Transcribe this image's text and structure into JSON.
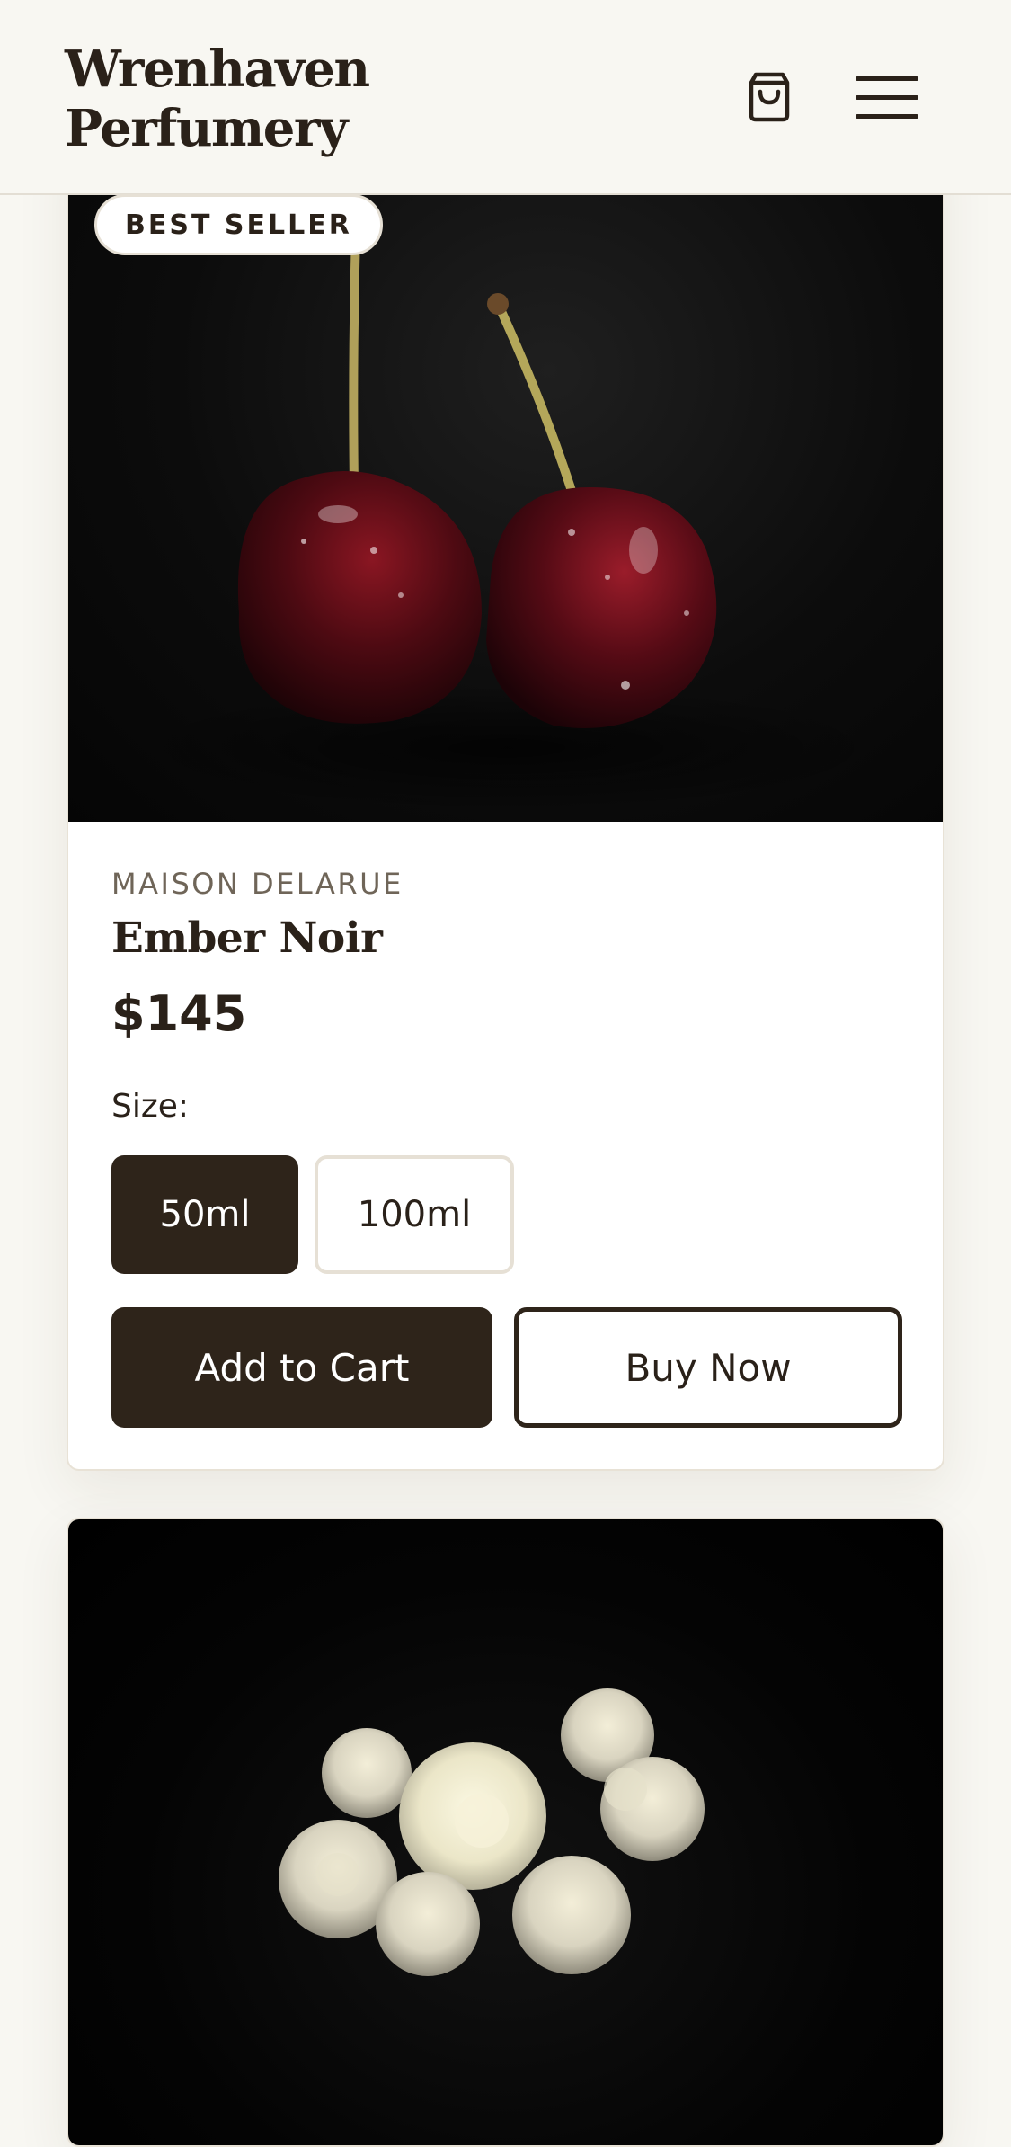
{
  "header": {
    "brand": "Wrenhaven Perfumery",
    "cart_icon": "shopping-bag-icon",
    "menu_icon": "hamburger-menu-icon"
  },
  "products": [
    {
      "badge": "BEST SELLER",
      "image_icon": "cherries-photo",
      "house": "MAISON DELARUE",
      "name": "Ember Noir",
      "price": "$145",
      "size_label": "Size:",
      "sizes": [
        {
          "label": "50ml",
          "selected": true
        },
        {
          "label": "100ml",
          "selected": false
        }
      ],
      "add_to_cart": "Add to Cart",
      "buy_now": "Buy Now"
    },
    {
      "image_icon": "white-flowers-photo"
    }
  ],
  "colors": {
    "background": "#f8f7f2",
    "primary_dark": "#2e241a",
    "card_border": "#e8e2d6",
    "muted_text": "#6f6558"
  }
}
